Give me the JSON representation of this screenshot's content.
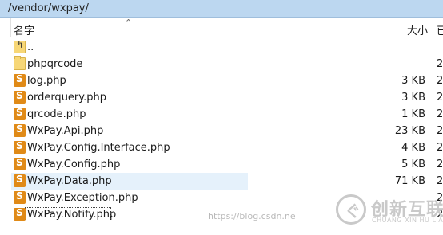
{
  "path": "/vendor/wxpay/",
  "columns": {
    "name": "名字",
    "size": "大小",
    "next": "已"
  },
  "files": [
    {
      "name": "..",
      "size": "",
      "type": "up",
      "trail": ""
    },
    {
      "name": "phpqrcode",
      "size": "",
      "type": "folder",
      "trail": "2"
    },
    {
      "name": "log.php",
      "size": "3 KB",
      "type": "php",
      "trail": "2"
    },
    {
      "name": "orderquery.php",
      "size": "3 KB",
      "type": "php",
      "trail": "2"
    },
    {
      "name": "qrcode.php",
      "size": "1 KB",
      "type": "php",
      "trail": "2"
    },
    {
      "name": "WxPay.Api.php",
      "size": "23 KB",
      "type": "php",
      "trail": "2"
    },
    {
      "name": "WxPay.Config.Interface.php",
      "size": "4 KB",
      "type": "php",
      "trail": "2"
    },
    {
      "name": "WxPay.Config.php",
      "size": "5 KB",
      "type": "php",
      "trail": "2"
    },
    {
      "name": "WxPay.Data.php",
      "size": "71 KB",
      "type": "php",
      "trail": "2"
    },
    {
      "name": "WxPay.Exception.php",
      "size": "",
      "type": "php",
      "trail": "2"
    },
    {
      "name": "WxPay.Notify.php",
      "size": "",
      "type": "php",
      "trail": "2"
    }
  ],
  "watermark": "https://blog.csdn.ne",
  "logo": {
    "cn": "创新互联",
    "en": "CHUANG XIN HU LIAN"
  },
  "colors": {
    "pathbar": "#bcd7f0",
    "highlight": "#e5f1fb",
    "php_icon": "#e08a17",
    "folder": "#f7d777"
  }
}
